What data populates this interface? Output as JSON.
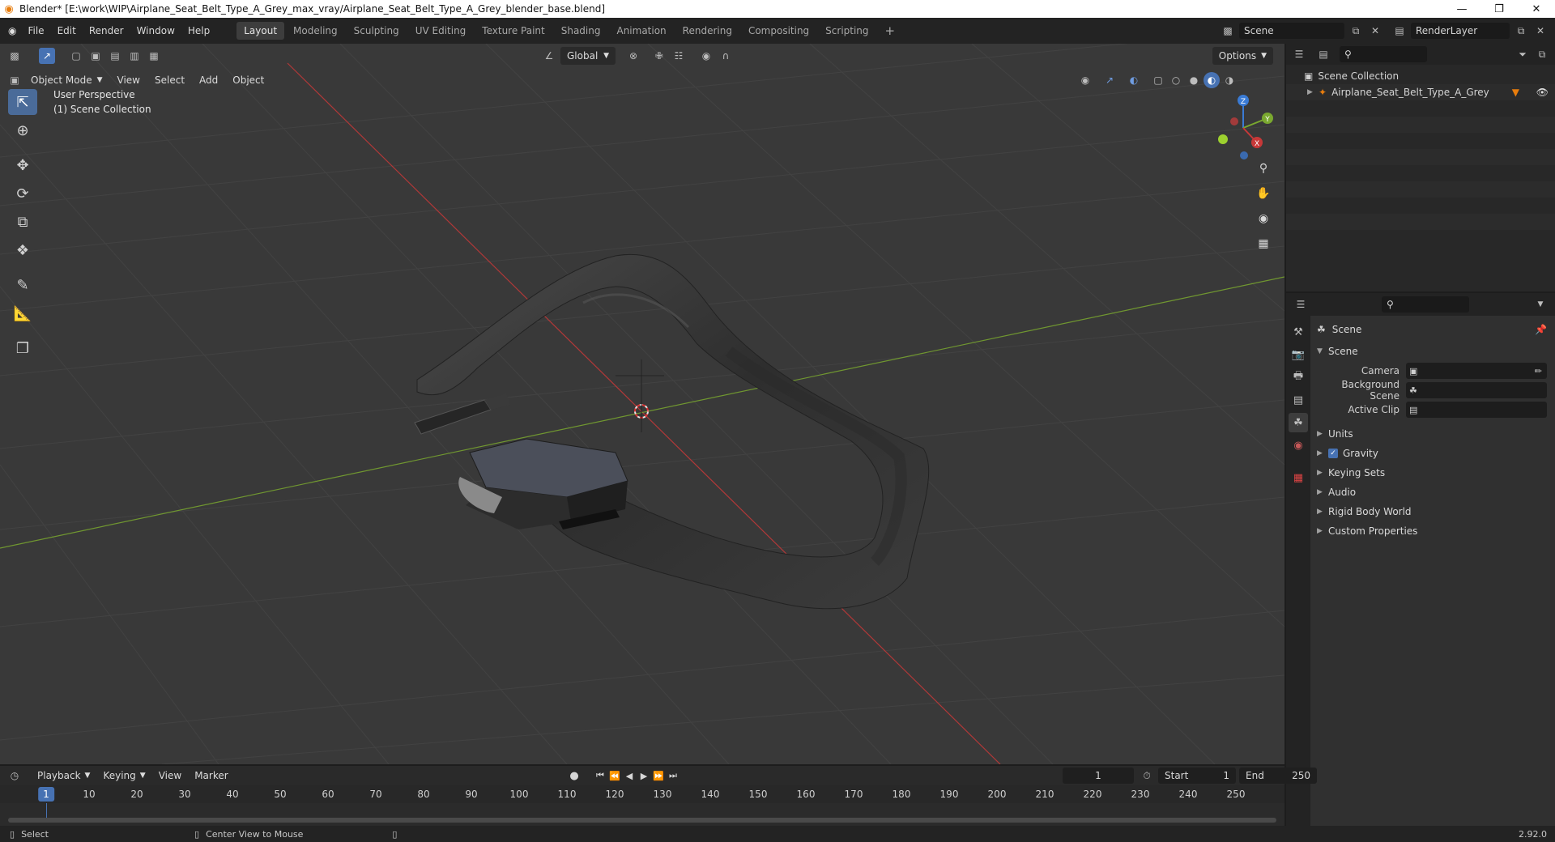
{
  "window": {
    "title": "Blender* [E:\\work\\WIP\\Airplane_Seat_Belt_Type_A_Grey_max_vray/Airplane_Seat_Belt_Type_A_Grey_blender_base.blend]"
  },
  "menu": [
    "File",
    "Edit",
    "Render",
    "Window",
    "Help"
  ],
  "workspaces": [
    "Layout",
    "Modeling",
    "Sculpting",
    "UV Editing",
    "Texture Paint",
    "Shading",
    "Animation",
    "Rendering",
    "Compositing",
    "Scripting"
  ],
  "active_workspace": "Layout",
  "scene_name": "Scene",
  "view_layer": "RenderLayer",
  "viewport": {
    "mode": "Object Mode",
    "menus": [
      "View",
      "Select",
      "Add",
      "Object"
    ],
    "transform_orientation": "Global",
    "options_label": "Options",
    "overlay_line1": "User Perspective",
    "overlay_line2": "(1) Scene Collection"
  },
  "gizmo": {
    "x": "X",
    "y": "Y",
    "z": "Z"
  },
  "outliner": {
    "root": "Scene Collection",
    "items": [
      {
        "name": "Airplane_Seat_Belt_Type_A_Grey"
      }
    ]
  },
  "properties": {
    "context": "Scene",
    "panel_scene": "Scene",
    "fields": [
      {
        "label": "Camera"
      },
      {
        "label": "Background Scene"
      },
      {
        "label": "Active Clip"
      }
    ],
    "panels": [
      "Units",
      "Gravity",
      "Keying Sets",
      "Audio",
      "Rigid Body World",
      "Custom Properties"
    ],
    "gravity_checked": true
  },
  "timeline": {
    "menus": [
      "Playback",
      "Keying",
      "View",
      "Marker"
    ],
    "current_frame": "1",
    "start_label": "Start",
    "start": "1",
    "end_label": "End",
    "end": "250",
    "ticks": [
      "10",
      "20",
      "30",
      "40",
      "50",
      "60",
      "70",
      "80",
      "90",
      "100",
      "110",
      "120",
      "130",
      "140",
      "150",
      "160",
      "170",
      "180",
      "190",
      "200",
      "210",
      "220",
      "230",
      "240",
      "250"
    ]
  },
  "status": {
    "left": "Select",
    "middle": "Center View to Mouse",
    "version": "2.92.0"
  },
  "colors": {
    "accent": "#4772b3",
    "x_axis": "#c73838",
    "y_axis": "#7aa82f",
    "z_axis": "#3a7bd5",
    "object_icon": "#e87d0d"
  }
}
